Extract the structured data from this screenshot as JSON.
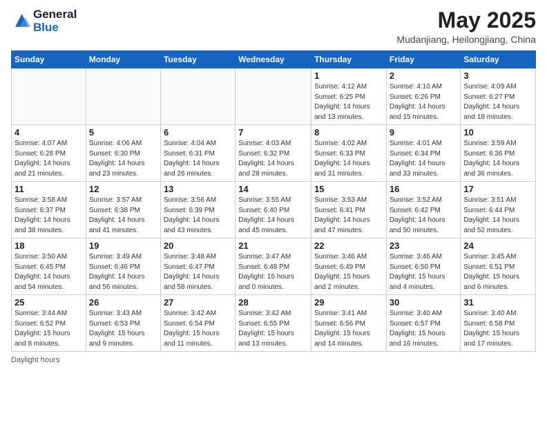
{
  "logo": {
    "line1": "General",
    "line2": "Blue"
  },
  "title": "May 2025",
  "location": "Mudanjiang, Heilongjiang, China",
  "days_of_week": [
    "Sunday",
    "Monday",
    "Tuesday",
    "Wednesday",
    "Thursday",
    "Friday",
    "Saturday"
  ],
  "footer": "Daylight hours",
  "weeks": [
    [
      {
        "day": "",
        "info": ""
      },
      {
        "day": "",
        "info": ""
      },
      {
        "day": "",
        "info": ""
      },
      {
        "day": "",
        "info": ""
      },
      {
        "day": "1",
        "info": "Sunrise: 4:12 AM\nSunset: 6:25 PM\nDaylight: 14 hours\nand 13 minutes."
      },
      {
        "day": "2",
        "info": "Sunrise: 4:10 AM\nSunset: 6:26 PM\nDaylight: 14 hours\nand 15 minutes."
      },
      {
        "day": "3",
        "info": "Sunrise: 4:09 AM\nSunset: 6:27 PM\nDaylight: 14 hours\nand 18 minutes."
      }
    ],
    [
      {
        "day": "4",
        "info": "Sunrise: 4:07 AM\nSunset: 6:28 PM\nDaylight: 14 hours\nand 21 minutes."
      },
      {
        "day": "5",
        "info": "Sunrise: 4:06 AM\nSunset: 6:30 PM\nDaylight: 14 hours\nand 23 minutes."
      },
      {
        "day": "6",
        "info": "Sunrise: 4:04 AM\nSunset: 6:31 PM\nDaylight: 14 hours\nand 26 minutes."
      },
      {
        "day": "7",
        "info": "Sunrise: 4:03 AM\nSunset: 6:32 PM\nDaylight: 14 hours\nand 28 minutes."
      },
      {
        "day": "8",
        "info": "Sunrise: 4:02 AM\nSunset: 6:33 PM\nDaylight: 14 hours\nand 31 minutes."
      },
      {
        "day": "9",
        "info": "Sunrise: 4:01 AM\nSunset: 6:34 PM\nDaylight: 14 hours\nand 33 minutes."
      },
      {
        "day": "10",
        "info": "Sunrise: 3:59 AM\nSunset: 6:36 PM\nDaylight: 14 hours\nand 36 minutes."
      }
    ],
    [
      {
        "day": "11",
        "info": "Sunrise: 3:58 AM\nSunset: 6:37 PM\nDaylight: 14 hours\nand 38 minutes."
      },
      {
        "day": "12",
        "info": "Sunrise: 3:57 AM\nSunset: 6:38 PM\nDaylight: 14 hours\nand 41 minutes."
      },
      {
        "day": "13",
        "info": "Sunrise: 3:56 AM\nSunset: 6:39 PM\nDaylight: 14 hours\nand 43 minutes."
      },
      {
        "day": "14",
        "info": "Sunrise: 3:55 AM\nSunset: 6:40 PM\nDaylight: 14 hours\nand 45 minutes."
      },
      {
        "day": "15",
        "info": "Sunrise: 3:53 AM\nSunset: 6:41 PM\nDaylight: 14 hours\nand 47 minutes."
      },
      {
        "day": "16",
        "info": "Sunrise: 3:52 AM\nSunset: 6:42 PM\nDaylight: 14 hours\nand 50 minutes."
      },
      {
        "day": "17",
        "info": "Sunrise: 3:51 AM\nSunset: 6:44 PM\nDaylight: 14 hours\nand 52 minutes."
      }
    ],
    [
      {
        "day": "18",
        "info": "Sunrise: 3:50 AM\nSunset: 6:45 PM\nDaylight: 14 hours\nand 54 minutes."
      },
      {
        "day": "19",
        "info": "Sunrise: 3:49 AM\nSunset: 6:46 PM\nDaylight: 14 hours\nand 56 minutes."
      },
      {
        "day": "20",
        "info": "Sunrise: 3:48 AM\nSunset: 6:47 PM\nDaylight: 14 hours\nand 58 minutes."
      },
      {
        "day": "21",
        "info": "Sunrise: 3:47 AM\nSunset: 6:48 PM\nDaylight: 15 hours\nand 0 minutes."
      },
      {
        "day": "22",
        "info": "Sunrise: 3:46 AM\nSunset: 6:49 PM\nDaylight: 15 hours\nand 2 minutes."
      },
      {
        "day": "23",
        "info": "Sunrise: 3:46 AM\nSunset: 6:50 PM\nDaylight: 15 hours\nand 4 minutes."
      },
      {
        "day": "24",
        "info": "Sunrise: 3:45 AM\nSunset: 6:51 PM\nDaylight: 15 hours\nand 6 minutes."
      }
    ],
    [
      {
        "day": "25",
        "info": "Sunrise: 3:44 AM\nSunset: 6:52 PM\nDaylight: 15 hours\nand 8 minutes."
      },
      {
        "day": "26",
        "info": "Sunrise: 3:43 AM\nSunset: 6:53 PM\nDaylight: 15 hours\nand 9 minutes."
      },
      {
        "day": "27",
        "info": "Sunrise: 3:42 AM\nSunset: 6:54 PM\nDaylight: 15 hours\nand 11 minutes."
      },
      {
        "day": "28",
        "info": "Sunrise: 3:42 AM\nSunset: 6:55 PM\nDaylight: 15 hours\nand 13 minutes."
      },
      {
        "day": "29",
        "info": "Sunrise: 3:41 AM\nSunset: 6:56 PM\nDaylight: 15 hours\nand 14 minutes."
      },
      {
        "day": "30",
        "info": "Sunrise: 3:40 AM\nSunset: 6:57 PM\nDaylight: 15 hours\nand 16 minutes."
      },
      {
        "day": "31",
        "info": "Sunrise: 3:40 AM\nSunset: 6:58 PM\nDaylight: 15 hours\nand 17 minutes."
      }
    ]
  ]
}
